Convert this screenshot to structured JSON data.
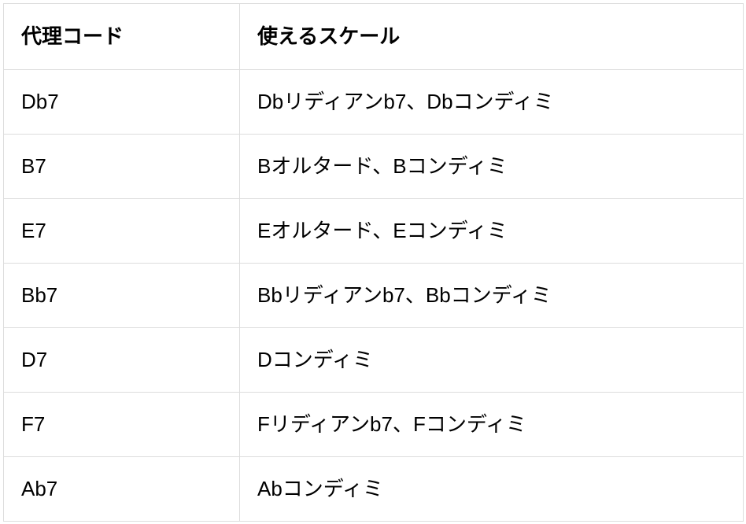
{
  "table": {
    "headers": {
      "chord": "代理コード",
      "scale": "使えるスケール"
    },
    "rows": [
      {
        "chord": "Db7",
        "scale": "Dbリディアンb7、Dbコンディミ"
      },
      {
        "chord": "B7",
        "scale": "Bオルタード、Bコンディミ"
      },
      {
        "chord": "E7",
        "scale": "Eオルタード、Eコンディミ"
      },
      {
        "chord": "Bb7",
        "scale": "Bbリディアンb7、Bbコンディミ"
      },
      {
        "chord": "D7",
        "scale": "Dコンディミ"
      },
      {
        "chord": "F7",
        "scale": "Fリディアンb7、Fコンディミ"
      },
      {
        "chord": "Ab7",
        "scale": "Abコンディミ"
      }
    ]
  }
}
